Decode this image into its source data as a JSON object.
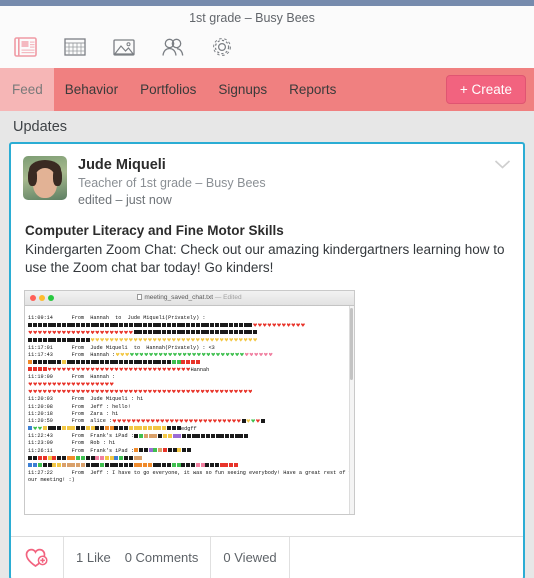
{
  "window": {
    "title": "1st grade – Busy Bees"
  },
  "toolbar": {
    "icons": [
      {
        "name": "feed-icon",
        "label": "Feed",
        "active": true
      },
      {
        "name": "grid-icon",
        "label": "Grid",
        "active": false
      },
      {
        "name": "photos-icon",
        "label": "Photos",
        "active": false
      },
      {
        "name": "people-icon",
        "label": "People",
        "active": false
      },
      {
        "name": "gear-icon",
        "label": "Settings",
        "active": false
      }
    ]
  },
  "navbar": {
    "tabs": [
      {
        "label": "Feed",
        "active": true
      },
      {
        "label": "Behavior",
        "active": false
      },
      {
        "label": "Portfolios",
        "active": false
      },
      {
        "label": "Signups",
        "active": false
      },
      {
        "label": "Reports",
        "active": false
      }
    ],
    "create_label": "+ Create",
    "accent_pink": "#f08080",
    "accent_active_tab": "#f6b6b6",
    "create_button_color": "#f2637f"
  },
  "section": {
    "updates_heading": "Updates"
  },
  "post": {
    "author": "Jude Miqueli",
    "role": "Teacher of 1st grade – Busy Bees",
    "timestamp": "edited – just now",
    "title": "Computer Literacy and Fine Motor Skills",
    "body": "Kindergarten Zoom Chat: Check out our amazing kindergartners learning how to use the Zoom chat bar today! Go kinders!",
    "card_border_color": "#2badd4",
    "footer": {
      "like": "1 Like",
      "comments": "0 Comments",
      "viewed": "0 Viewed"
    }
  },
  "attachment": {
    "filename": "meeting_saved_chat.txt",
    "edited_label": "— Edited",
    "lines": [
      {
        "time": "11:09:14",
        "text": "From  Hannah  to  Jude Miqueli(Privately) :"
      },
      {
        "time": "11:17:01",
        "text": "From  Jude Miqueli  to  Hannah(Privately) : <3"
      },
      {
        "time": "11:17:43",
        "text": "From  Hannah :"
      },
      {
        "time": "11:19:00",
        "text": "From  Hannah :"
      },
      {
        "time": "11:20:03",
        "text": "From  Jude Miqueli : hi"
      },
      {
        "time": "11:20:08",
        "text": "From  Jeff : hello!"
      },
      {
        "time": "11:20:18",
        "text": "From  Zara : hi"
      },
      {
        "time": "11:20:50",
        "text": "From  alice :"
      },
      {
        "time": "11:22:43",
        "text": "From  Frank's iPad :"
      },
      {
        "time": "11:23:09",
        "text": "From  Rob : hi"
      },
      {
        "time": "11:26:11",
        "text": "From  Frank's iPad :"
      },
      {
        "time": "11:27:22",
        "text": "From  Jeff : I have to go everyone, it was so fun seeing everybody! Have a great rest of your meeting! :)"
      }
    ],
    "trailing_word_1": "Hannah",
    "trailing_word_2": "edgff"
  }
}
